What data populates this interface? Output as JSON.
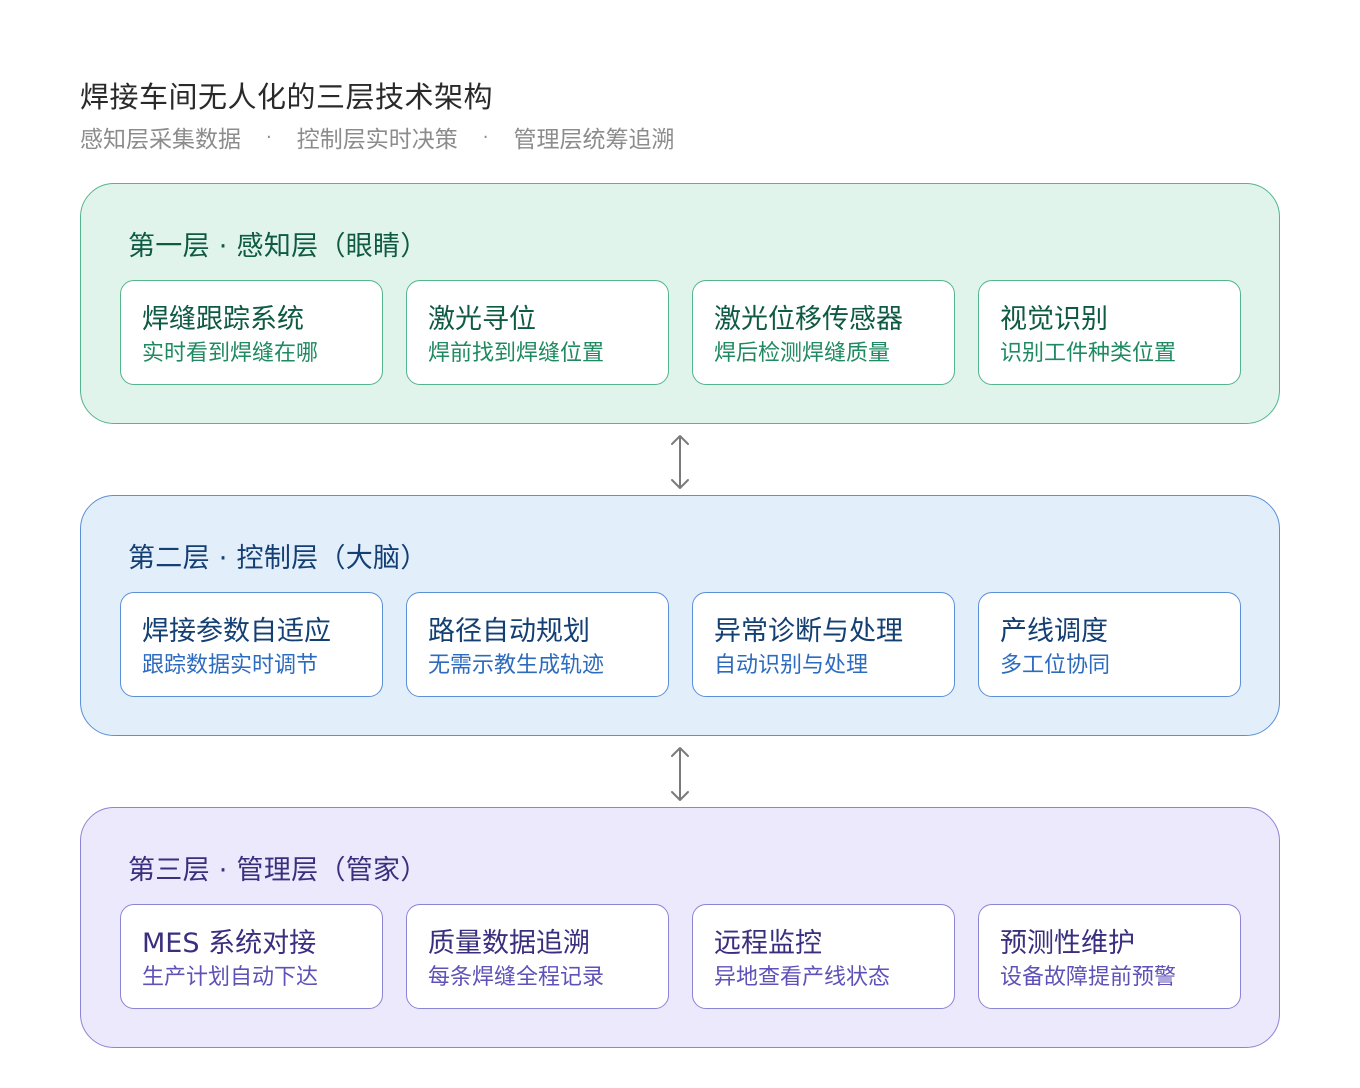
{
  "header": {
    "title": "焊接车间无人化的三层技术架构",
    "subtitle_items": [
      "感知层采集数据",
      "控制层实时决策",
      "管理层统筹追溯"
    ],
    "separator": "·"
  },
  "layers": [
    {
      "title": "第一层 · 感知层（眼睛）",
      "color": "#54b48e",
      "cards": [
        {
          "title": "焊缝跟踪系统",
          "desc": "实时看到焊缝在哪"
        },
        {
          "title": "激光寻位",
          "desc": "焊前找到焊缝位置"
        },
        {
          "title": "激光位移传感器",
          "desc": "焊后检测焊缝质量"
        },
        {
          "title": "视觉识别",
          "desc": "识别工件种类位置"
        }
      ]
    },
    {
      "title": "第二层 · 控制层（大脑）",
      "color": "#5a90d6",
      "cards": [
        {
          "title": "焊接参数自适应",
          "desc": "跟踪数据实时调节"
        },
        {
          "title": "路径自动规划",
          "desc": "无需示教生成轨迹"
        },
        {
          "title": "异常诊断与处理",
          "desc": "自动识别与处理"
        },
        {
          "title": "产线调度",
          "desc": "多工位协同"
        }
      ]
    },
    {
      "title": "第三层 · 管理层（管家）",
      "color": "#8c84d4",
      "cards": [
        {
          "title": "MES 系统对接",
          "desc": "生产计划自动下达"
        },
        {
          "title": "质量数据追溯",
          "desc": "每条焊缝全程记录"
        },
        {
          "title": "远程监控",
          "desc": "异地查看产线状态"
        },
        {
          "title": "预测性维护",
          "desc": "设备故障提前预警"
        }
      ]
    }
  ],
  "connectors": [
    {
      "icon": "double-arrow-vertical-icon"
    },
    {
      "icon": "double-arrow-vertical-icon"
    }
  ]
}
